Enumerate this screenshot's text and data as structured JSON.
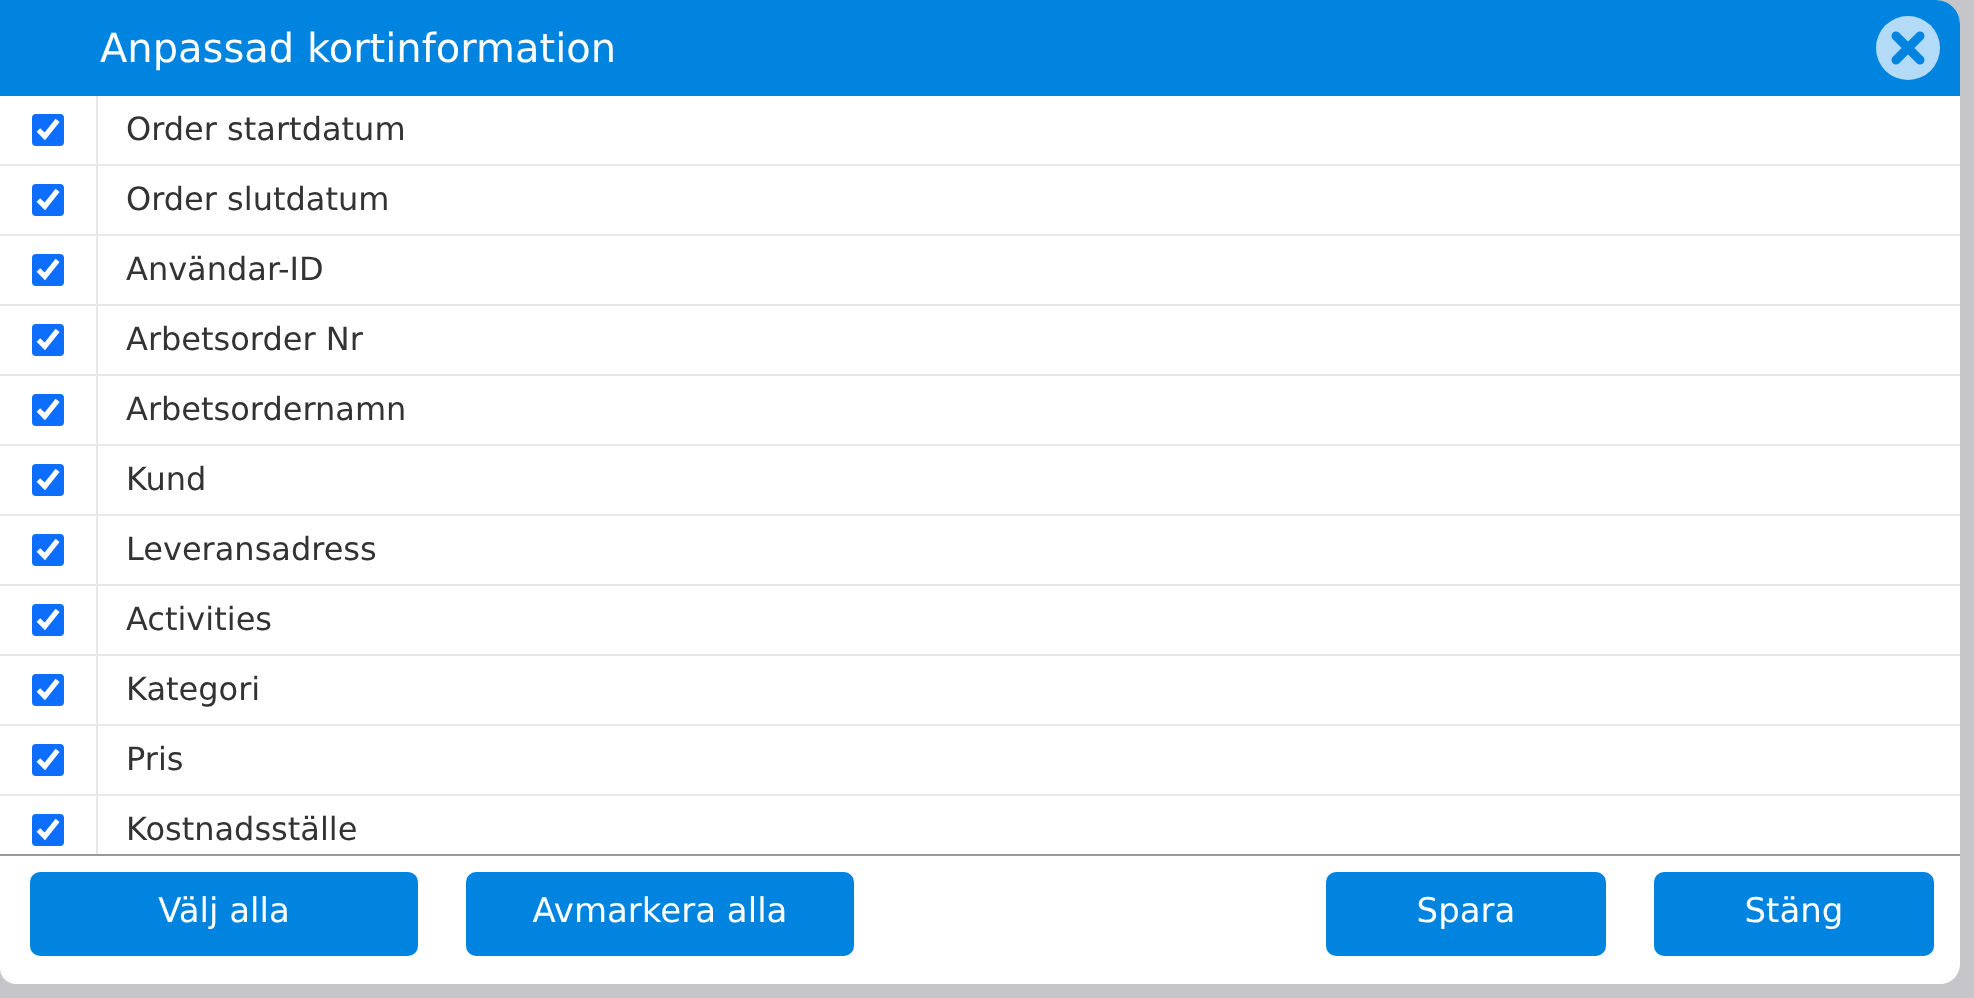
{
  "dialog": {
    "title": "Anpassad kortinformation"
  },
  "fields": [
    {
      "label": "Order startdatum",
      "checked": true
    },
    {
      "label": "Order slutdatum",
      "checked": true
    },
    {
      "label": "Användar-ID",
      "checked": true
    },
    {
      "label": "Arbetsorder Nr",
      "checked": true
    },
    {
      "label": "Arbetsordernamn",
      "checked": true
    },
    {
      "label": "Kund",
      "checked": true
    },
    {
      "label": "Leveransadress",
      "checked": true
    },
    {
      "label": "Activities",
      "checked": true
    },
    {
      "label": "Kategori",
      "checked": true
    },
    {
      "label": "Pris",
      "checked": true
    },
    {
      "label": "Kostnadsställe",
      "checked": true
    }
  ],
  "buttons_left": [
    "Välj alla",
    "Avmarkera alla"
  ],
  "buttons_right": [
    "Spara",
    "Stäng"
  ]
}
